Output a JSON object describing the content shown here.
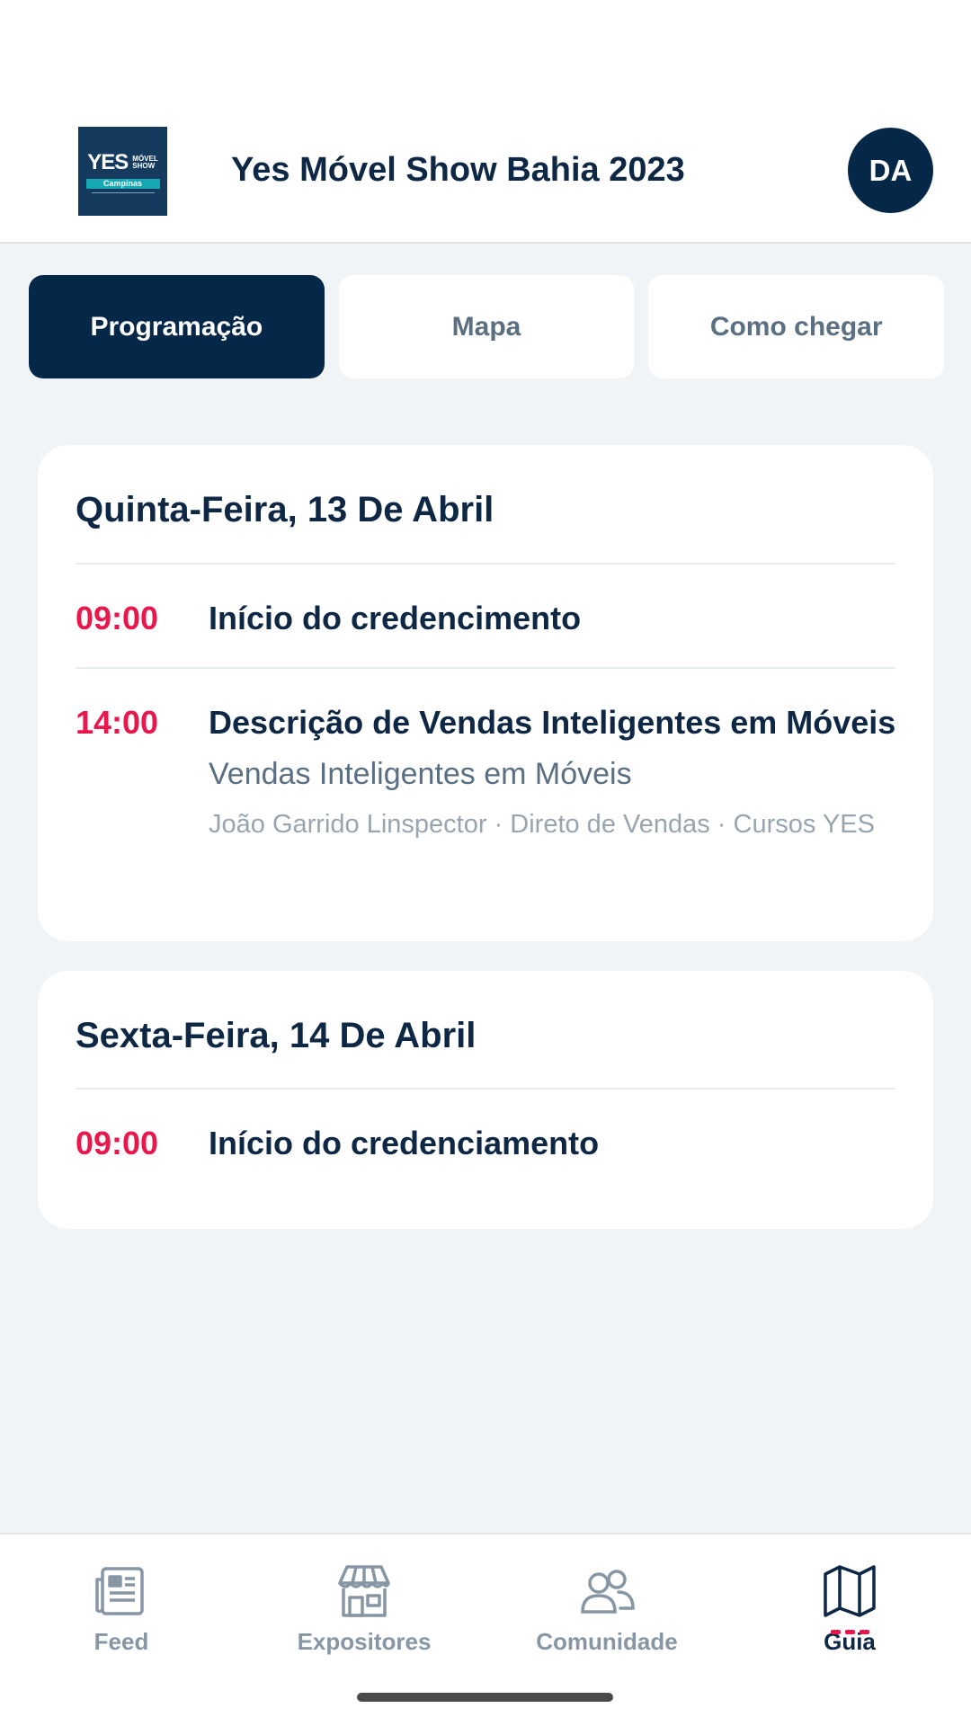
{
  "header": {
    "logo": {
      "brand": "YES",
      "line1": "MÓVEL",
      "line2": "SHOW",
      "band": "Campinas"
    },
    "title": "Yes Móvel Show Bahia 2023",
    "avatar_initials": "DA"
  },
  "tabs": [
    {
      "label": "Programação",
      "active": true
    },
    {
      "label": "Mapa",
      "active": false
    },
    {
      "label": "Como chegar",
      "active": false
    }
  ],
  "days": [
    {
      "title": "Quinta-Feira, 13 De Abril",
      "events": [
        {
          "time": "09:00",
          "title": "Início do credencimento"
        },
        {
          "time": "14:00",
          "title": "Descrição de Vendas Inteligentes em Móveis",
          "subtitle": "Vendas Inteligentes em Móveis",
          "meta": "João Garrido Linspector · Direto de Vendas · Cursos YES"
        }
      ]
    },
    {
      "title": "Sexta-Feira, 14 De Abril",
      "events": [
        {
          "time": "09:00",
          "title": "Início do credenciamento"
        }
      ]
    }
  ],
  "bottom_nav": [
    {
      "label": "Feed",
      "icon": "newspaper-icon"
    },
    {
      "label": "Expositores",
      "icon": "store-icon"
    },
    {
      "label": "Comunidade",
      "icon": "people-icon"
    },
    {
      "label": "Guia",
      "icon": "map-icon",
      "active": true
    }
  ],
  "colors": {
    "primary": "#052748",
    "accent": "#e8174c",
    "background": "#f1f4f7",
    "muted": "#8796a4"
  }
}
